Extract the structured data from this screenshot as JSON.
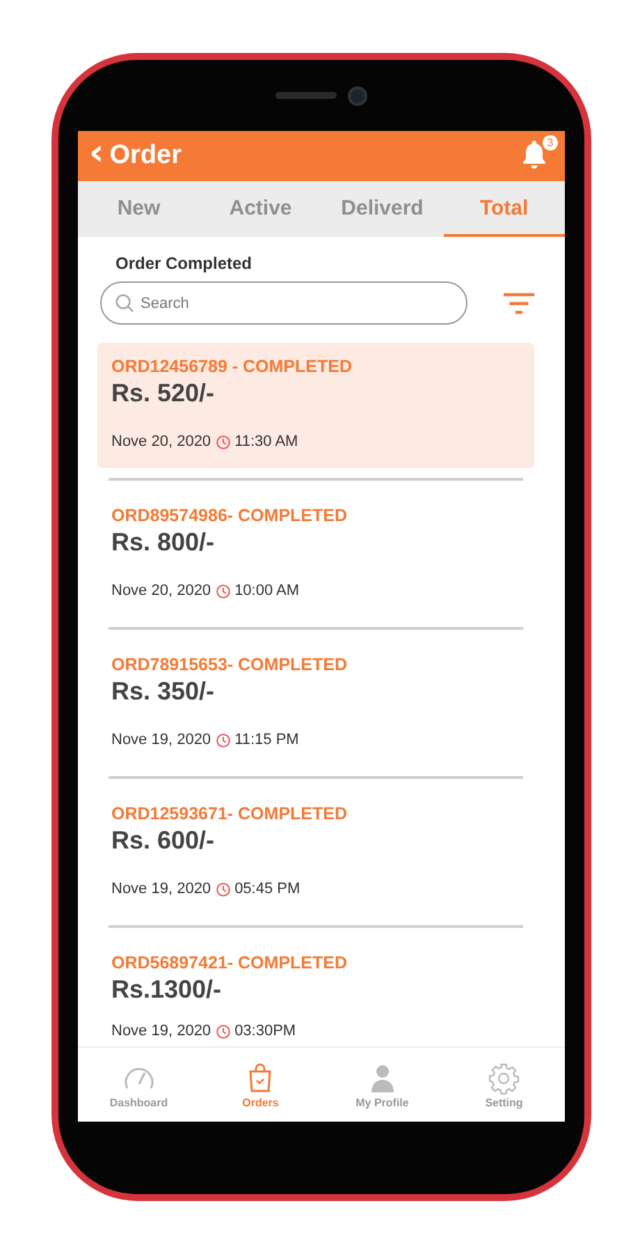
{
  "header": {
    "back": "‹",
    "title": "Order",
    "notifications": "3"
  },
  "tabs": [
    {
      "label": "New",
      "selected": false
    },
    {
      "label": "Active",
      "selected": false
    },
    {
      "label": "Deliverd",
      "selected": false
    },
    {
      "label": "Total",
      "selected": true
    }
  ],
  "section_title": "Order Completed",
  "search": {
    "placeholder": "Search"
  },
  "orders": [
    {
      "title": "ORD12456789 - COMPLETED",
      "amount": "Rs. 520/-",
      "date": "Nove 20, 2020",
      "time": "11:30 AM",
      "selected": true
    },
    {
      "title": "ORD89574986- COMPLETED",
      "amount": "Rs. 800/-",
      "date": "Nove 20, 2020",
      "time": "10:00 AM",
      "selected": false
    },
    {
      "title": "ORD78915653- COMPLETED",
      "amount": "Rs. 350/-",
      "date": "Nove 19, 2020",
      "time": "11:15 PM",
      "selected": false
    },
    {
      "title": "ORD12593671- COMPLETED",
      "amount": "Rs. 600/-",
      "date": "Nove 19, 2020",
      "time": "05:45 PM",
      "selected": false
    },
    {
      "title": "ORD56897421- COMPLETED",
      "amount": "Rs.1300/-",
      "date": "Nove 19, 2020",
      "time": "03:30PM",
      "selected": false
    }
  ],
  "nav": [
    {
      "kind": "dashboard",
      "label": "Dashboard",
      "selected": false
    },
    {
      "kind": "orders",
      "label": "Orders",
      "selected": true
    },
    {
      "kind": "profile",
      "label": "My Profile",
      "selected": false
    },
    {
      "kind": "setting",
      "label": "Setting",
      "selected": false
    }
  ]
}
